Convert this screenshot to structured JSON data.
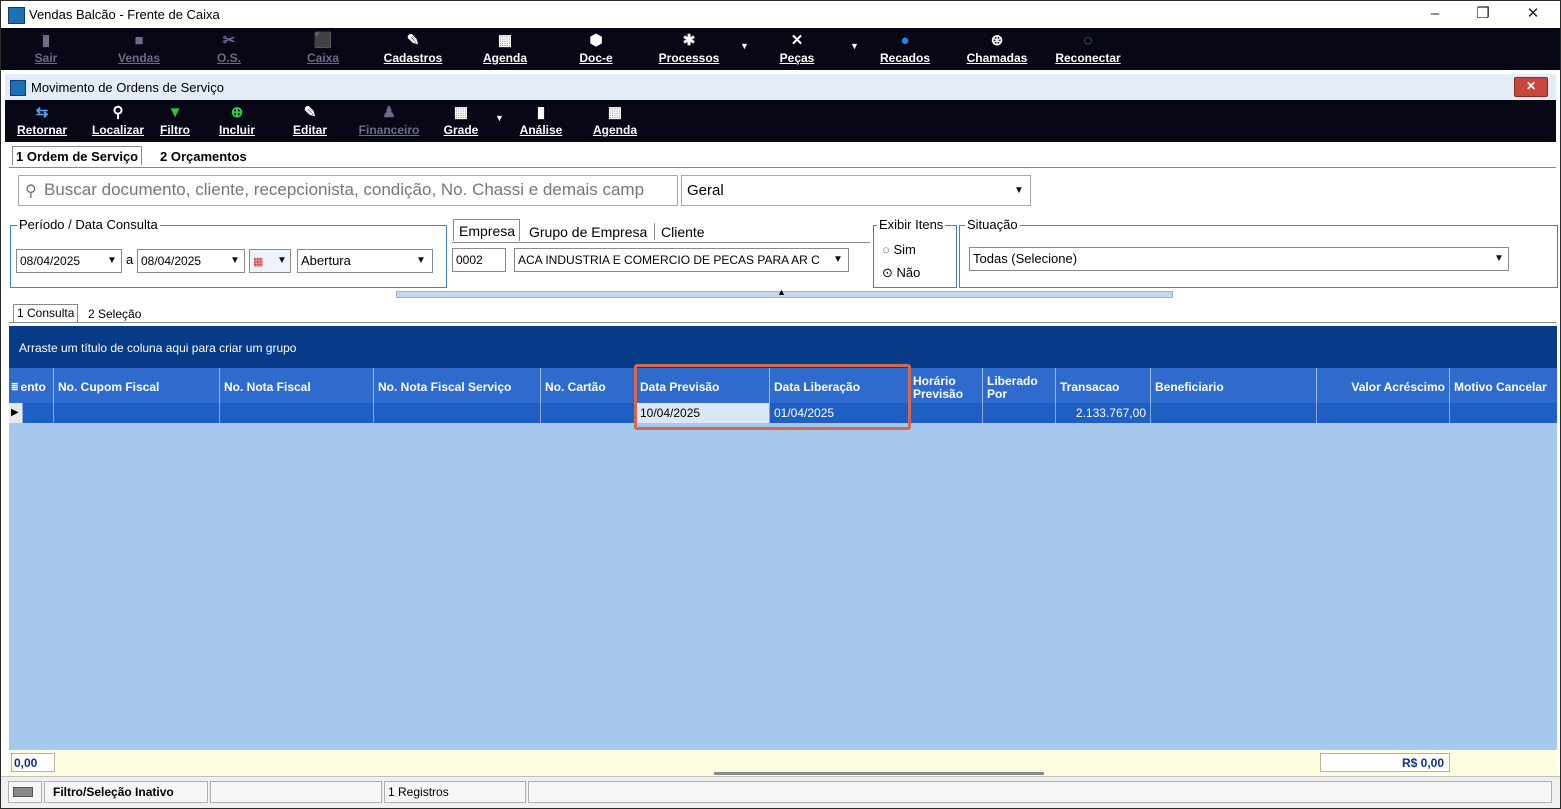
{
  "window": {
    "title": "Vendas Balcão - Frente de Caixa",
    "minimize": "–",
    "restore": "❐",
    "close": "✕"
  },
  "main_toolbar": {
    "items": [
      {
        "label": "Sair",
        "icon": "▮"
      },
      {
        "label": "Vendas",
        "icon": "■"
      },
      {
        "label": "O.S.",
        "icon": "✂"
      },
      {
        "label": "Caixa",
        "icon": "⬛"
      },
      {
        "label": "Cadastros",
        "icon": "✎"
      },
      {
        "label": "Agenda",
        "icon": "▦"
      },
      {
        "label": "Doc-e",
        "icon": "⬢"
      },
      {
        "label": "Processos",
        "icon": "✱"
      },
      {
        "label": "Peças",
        "icon": "✕"
      },
      {
        "label": "Recados",
        "icon": "●"
      },
      {
        "label": "Chamadas",
        "icon": "⊛"
      },
      {
        "label": "Reconectar",
        "icon": "◌"
      }
    ]
  },
  "inner_window": {
    "title": "Movimento de Ordens de Serviço",
    "close": "✕"
  },
  "sub_toolbar": {
    "items": [
      {
        "label": "Retornar",
        "icon": "⇆"
      },
      {
        "label": "Localizar",
        "icon": "⚲"
      },
      {
        "label": "Filtro",
        "icon": "▼"
      },
      {
        "label": "Incluir",
        "icon": "⊕"
      },
      {
        "label": "Editar",
        "icon": "✎"
      },
      {
        "label": "Financeiro",
        "icon": "♟"
      },
      {
        "label": "Grade",
        "icon": "▦"
      },
      {
        "label": "Análise",
        "icon": "▮"
      },
      {
        "label": "Agenda",
        "icon": "▦"
      }
    ]
  },
  "top_tabs": [
    "1 Ordem de Serviço",
    "2 Orçamentos"
  ],
  "search": {
    "placeholder": "Buscar documento, cliente, recepcionista, condição, No. Chassi e demais camp",
    "scope": "Geral"
  },
  "periodo": {
    "label": "Período / Data Consulta",
    "from": "08/04/2025",
    "sep": "a",
    "to": "08/04/2025",
    "type": "Abertura"
  },
  "empresa_tabs": [
    "Empresa",
    "Grupo de Empresa",
    "Cliente"
  ],
  "empresa": {
    "code": "0002",
    "name": "ACA INDUSTRIA E COMERCIO DE PECAS PARA AR C"
  },
  "exibir_itens": {
    "label": "Exibir Itens",
    "options": [
      "Sim",
      "Não"
    ]
  },
  "situacao": {
    "label": "Situação",
    "value": "Todas (Selecione)"
  },
  "result_tabs": [
    "1 Consulta",
    "2 Seleção"
  ],
  "grid": {
    "group_hint": "Arraste um título de coluna aqui para criar um grupo",
    "columns": [
      "ento",
      "No. Cupom Fiscal",
      "No. Nota Fiscal",
      "No. Nota Fiscal Serviço",
      "No. Cartão",
      "Data Previsão",
      "Data Liberação",
      "Horário Previsão",
      "Liberado Por",
      "Transacao",
      "Beneficiario",
      "Valor Acréscimo",
      "Motivo Cancelar"
    ],
    "row": {
      "data_previsao": "10/04/2025",
      "data_liberacao": "01/04/2025",
      "transacao": "2.133.767,00"
    },
    "footer_left": "0,00",
    "footer_right": "R$ 0,00"
  },
  "status": {
    "panel1": "Filtro/Seleção Inativo",
    "panel3": "1 Registros"
  }
}
